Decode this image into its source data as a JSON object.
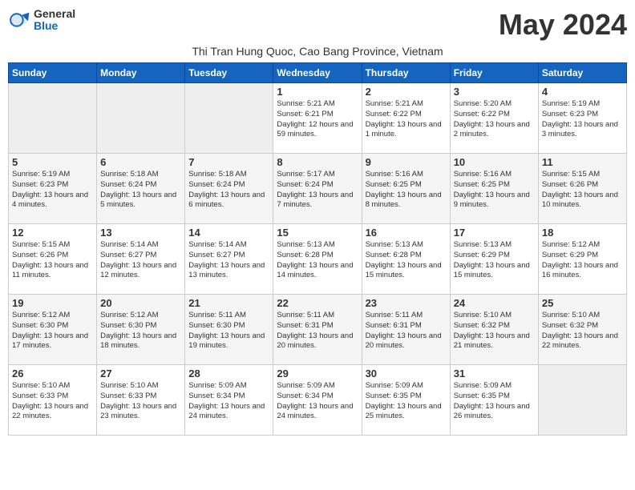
{
  "logo": {
    "general": "General",
    "blue": "Blue"
  },
  "title": "May 2024",
  "subtitle": "Thi Tran Hung Quoc, Cao Bang Province, Vietnam",
  "days_of_week": [
    "Sunday",
    "Monday",
    "Tuesday",
    "Wednesday",
    "Thursday",
    "Friday",
    "Saturday"
  ],
  "weeks": [
    [
      {
        "num": "",
        "sunrise": "",
        "sunset": "",
        "daylight": "",
        "empty": true
      },
      {
        "num": "",
        "sunrise": "",
        "sunset": "",
        "daylight": "",
        "empty": true
      },
      {
        "num": "",
        "sunrise": "",
        "sunset": "",
        "daylight": "",
        "empty": true
      },
      {
        "num": "1",
        "sunrise": "Sunrise: 5:21 AM",
        "sunset": "Sunset: 6:21 PM",
        "daylight": "Daylight: 12 hours and 59 minutes.",
        "empty": false
      },
      {
        "num": "2",
        "sunrise": "Sunrise: 5:21 AM",
        "sunset": "Sunset: 6:22 PM",
        "daylight": "Daylight: 13 hours and 1 minute.",
        "empty": false
      },
      {
        "num": "3",
        "sunrise": "Sunrise: 5:20 AM",
        "sunset": "Sunset: 6:22 PM",
        "daylight": "Daylight: 13 hours and 2 minutes.",
        "empty": false
      },
      {
        "num": "4",
        "sunrise": "Sunrise: 5:19 AM",
        "sunset": "Sunset: 6:23 PM",
        "daylight": "Daylight: 13 hours and 3 minutes.",
        "empty": false
      }
    ],
    [
      {
        "num": "5",
        "sunrise": "Sunrise: 5:19 AM",
        "sunset": "Sunset: 6:23 PM",
        "daylight": "Daylight: 13 hours and 4 minutes.",
        "empty": false
      },
      {
        "num": "6",
        "sunrise": "Sunrise: 5:18 AM",
        "sunset": "Sunset: 6:24 PM",
        "daylight": "Daylight: 13 hours and 5 minutes.",
        "empty": false
      },
      {
        "num": "7",
        "sunrise": "Sunrise: 5:18 AM",
        "sunset": "Sunset: 6:24 PM",
        "daylight": "Daylight: 13 hours and 6 minutes.",
        "empty": false
      },
      {
        "num": "8",
        "sunrise": "Sunrise: 5:17 AM",
        "sunset": "Sunset: 6:24 PM",
        "daylight": "Daylight: 13 hours and 7 minutes.",
        "empty": false
      },
      {
        "num": "9",
        "sunrise": "Sunrise: 5:16 AM",
        "sunset": "Sunset: 6:25 PM",
        "daylight": "Daylight: 13 hours and 8 minutes.",
        "empty": false
      },
      {
        "num": "10",
        "sunrise": "Sunrise: 5:16 AM",
        "sunset": "Sunset: 6:25 PM",
        "daylight": "Daylight: 13 hours and 9 minutes.",
        "empty": false
      },
      {
        "num": "11",
        "sunrise": "Sunrise: 5:15 AM",
        "sunset": "Sunset: 6:26 PM",
        "daylight": "Daylight: 13 hours and 10 minutes.",
        "empty": false
      }
    ],
    [
      {
        "num": "12",
        "sunrise": "Sunrise: 5:15 AM",
        "sunset": "Sunset: 6:26 PM",
        "daylight": "Daylight: 13 hours and 11 minutes.",
        "empty": false
      },
      {
        "num": "13",
        "sunrise": "Sunrise: 5:14 AM",
        "sunset": "Sunset: 6:27 PM",
        "daylight": "Daylight: 13 hours and 12 minutes.",
        "empty": false
      },
      {
        "num": "14",
        "sunrise": "Sunrise: 5:14 AM",
        "sunset": "Sunset: 6:27 PM",
        "daylight": "Daylight: 13 hours and 13 minutes.",
        "empty": false
      },
      {
        "num": "15",
        "sunrise": "Sunrise: 5:13 AM",
        "sunset": "Sunset: 6:28 PM",
        "daylight": "Daylight: 13 hours and 14 minutes.",
        "empty": false
      },
      {
        "num": "16",
        "sunrise": "Sunrise: 5:13 AM",
        "sunset": "Sunset: 6:28 PM",
        "daylight": "Daylight: 13 hours and 15 minutes.",
        "empty": false
      },
      {
        "num": "17",
        "sunrise": "Sunrise: 5:13 AM",
        "sunset": "Sunset: 6:29 PM",
        "daylight": "Daylight: 13 hours and 15 minutes.",
        "empty": false
      },
      {
        "num": "18",
        "sunrise": "Sunrise: 5:12 AM",
        "sunset": "Sunset: 6:29 PM",
        "daylight": "Daylight: 13 hours and 16 minutes.",
        "empty": false
      }
    ],
    [
      {
        "num": "19",
        "sunrise": "Sunrise: 5:12 AM",
        "sunset": "Sunset: 6:30 PM",
        "daylight": "Daylight: 13 hours and 17 minutes.",
        "empty": false
      },
      {
        "num": "20",
        "sunrise": "Sunrise: 5:12 AM",
        "sunset": "Sunset: 6:30 PM",
        "daylight": "Daylight: 13 hours and 18 minutes.",
        "empty": false
      },
      {
        "num": "21",
        "sunrise": "Sunrise: 5:11 AM",
        "sunset": "Sunset: 6:30 PM",
        "daylight": "Daylight: 13 hours and 19 minutes.",
        "empty": false
      },
      {
        "num": "22",
        "sunrise": "Sunrise: 5:11 AM",
        "sunset": "Sunset: 6:31 PM",
        "daylight": "Daylight: 13 hours and 20 minutes.",
        "empty": false
      },
      {
        "num": "23",
        "sunrise": "Sunrise: 5:11 AM",
        "sunset": "Sunset: 6:31 PM",
        "daylight": "Daylight: 13 hours and 20 minutes.",
        "empty": false
      },
      {
        "num": "24",
        "sunrise": "Sunrise: 5:10 AM",
        "sunset": "Sunset: 6:32 PM",
        "daylight": "Daylight: 13 hours and 21 minutes.",
        "empty": false
      },
      {
        "num": "25",
        "sunrise": "Sunrise: 5:10 AM",
        "sunset": "Sunset: 6:32 PM",
        "daylight": "Daylight: 13 hours and 22 minutes.",
        "empty": false
      }
    ],
    [
      {
        "num": "26",
        "sunrise": "Sunrise: 5:10 AM",
        "sunset": "Sunset: 6:33 PM",
        "daylight": "Daylight: 13 hours and 22 minutes.",
        "empty": false
      },
      {
        "num": "27",
        "sunrise": "Sunrise: 5:10 AM",
        "sunset": "Sunset: 6:33 PM",
        "daylight": "Daylight: 13 hours and 23 minutes.",
        "empty": false
      },
      {
        "num": "28",
        "sunrise": "Sunrise: 5:09 AM",
        "sunset": "Sunset: 6:34 PM",
        "daylight": "Daylight: 13 hours and 24 minutes.",
        "empty": false
      },
      {
        "num": "29",
        "sunrise": "Sunrise: 5:09 AM",
        "sunset": "Sunset: 6:34 PM",
        "daylight": "Daylight: 13 hours and 24 minutes.",
        "empty": false
      },
      {
        "num": "30",
        "sunrise": "Sunrise: 5:09 AM",
        "sunset": "Sunset: 6:35 PM",
        "daylight": "Daylight: 13 hours and 25 minutes.",
        "empty": false
      },
      {
        "num": "31",
        "sunrise": "Sunrise: 5:09 AM",
        "sunset": "Sunset: 6:35 PM",
        "daylight": "Daylight: 13 hours and 26 minutes.",
        "empty": false
      },
      {
        "num": "",
        "sunrise": "",
        "sunset": "",
        "daylight": "",
        "empty": true
      }
    ]
  ]
}
